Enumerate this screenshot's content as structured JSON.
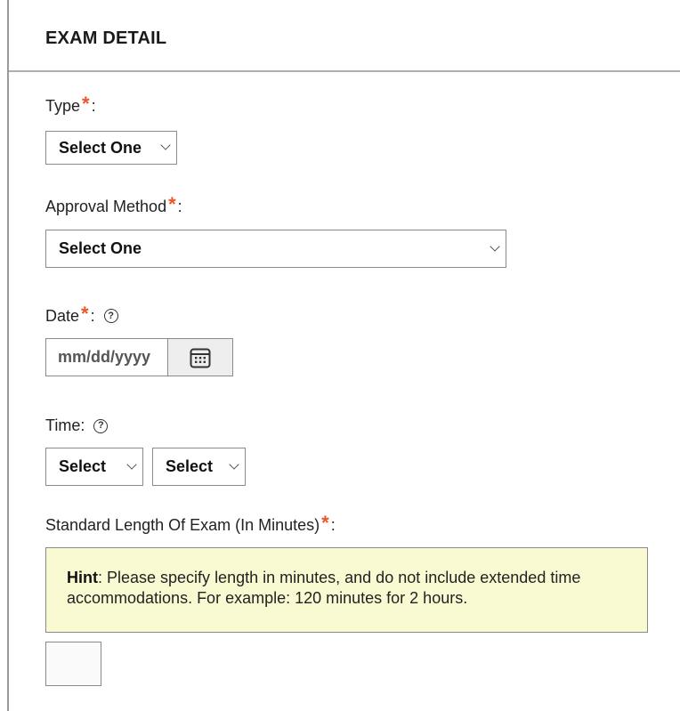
{
  "section": {
    "title": "EXAM DETAIL"
  },
  "type_field": {
    "label": "Type",
    "required_mark": "*",
    "colon": ":",
    "selected": "Select One"
  },
  "approval_field": {
    "label": "Approval Method",
    "required_mark": "*",
    "colon": ":",
    "selected": "Select One"
  },
  "date_field": {
    "label": "Date",
    "required_mark": "*",
    "colon": ":",
    "help_glyph": "?",
    "placeholder": "mm/dd/yyyy",
    "icons": [
      "help-icon",
      "calendar-icon"
    ]
  },
  "time_field": {
    "label": "Time:",
    "help_glyph": "?",
    "hour_selected": "Select",
    "minute_selected": "Select"
  },
  "length_field": {
    "label": "Standard Length Of Exam (In Minutes)",
    "required_mark": "*",
    "colon": ":",
    "hint_label": "Hint",
    "hint_text": ": Please specify length in minutes, and do not include extended time accommodations. For example: 120 minutes for 2 hours.",
    "value": ""
  },
  "colors": {
    "required": "#e8562a",
    "hint_background": "#fafad2",
    "border": "#8a8a8a"
  }
}
